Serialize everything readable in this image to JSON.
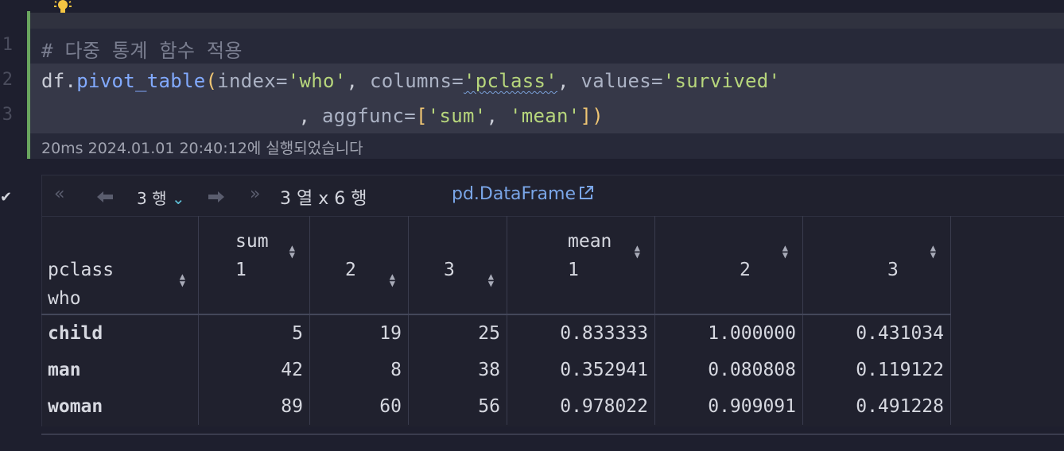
{
  "editor": {
    "line_numbers": [
      "1",
      "2",
      "3"
    ],
    "line1": "# 다중 통계 함수 적용",
    "line2": {
      "var": "df",
      "dot": ".",
      "method": "pivot_table",
      "open": "(",
      "arg1": "index=",
      "val1": "'who'",
      "sep1": ", ",
      "arg2": "columns=",
      "val2": "'pclass'",
      "sep2": ", ",
      "arg3": "values=",
      "val3": "'survived'"
    },
    "line3": {
      "lead": "          , ",
      "arg": "aggfunc=",
      "bopen": "[",
      "v1": "'sum'",
      "sep": ", ",
      "v2": "'mean'",
      "bclose": "]",
      "close": ")"
    },
    "status": "20ms 2024.01.01 20:40:12에 실행되었습니다"
  },
  "output": {
    "toolbar": {
      "first_icon": "double-left-chevron",
      "prev_icon": "left-arrow",
      "rows_selector": "3 행",
      "next_icon": "right-arrow",
      "last_icon": "double-right-chevron",
      "shape": "3 열 x 6 행",
      "type_link": "pd.DataFrame"
    },
    "table": {
      "index_header_top": "pclass",
      "index_header_bottom": "who",
      "columns": [
        {
          "level0": "sum",
          "level1": "1"
        },
        {
          "level0": "",
          "level1": "2"
        },
        {
          "level0": "",
          "level1": "3"
        },
        {
          "level0": "mean",
          "level1": "1"
        },
        {
          "level0": "",
          "level1": "2"
        },
        {
          "level0": "",
          "level1": "3"
        }
      ],
      "rows": [
        {
          "index": "child",
          "values": [
            "5",
            "19",
            "25",
            "0.833333",
            "1.000000",
            "0.431034"
          ]
        },
        {
          "index": "man",
          "values": [
            "42",
            "8",
            "38",
            "0.352941",
            "0.080808",
            "0.119122"
          ]
        },
        {
          "index": "woman",
          "values": [
            "89",
            "60",
            "56",
            "0.978022",
            "0.909091",
            "0.491228"
          ]
        }
      ]
    }
  },
  "colors": {
    "background": "#1e1f2e",
    "cell_marker": "#6aa65f",
    "string": "#b7d67c",
    "function": "#82aaff",
    "link": "#7aa6e8"
  }
}
